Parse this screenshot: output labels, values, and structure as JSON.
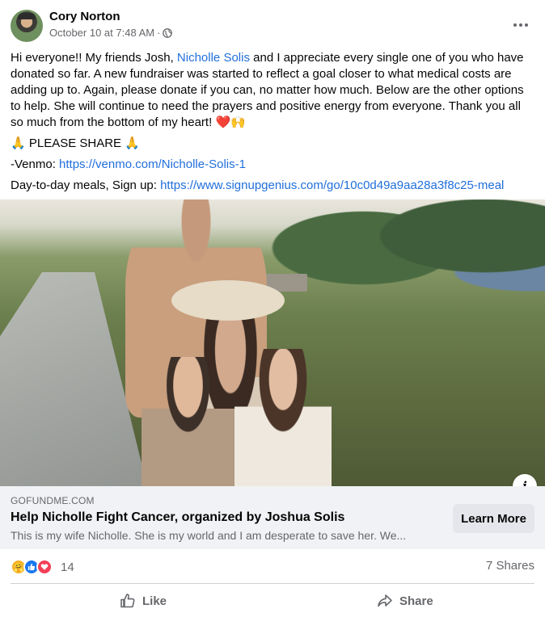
{
  "post": {
    "author": "Cory Norton",
    "timestamp": "October 10 at 7:48 AM",
    "separator": "·",
    "privacy_icon": "globe-icon",
    "more_icon": "more-horizontal-icon"
  },
  "content": {
    "p1_part1": "Hi everyone!! My friends Josh, ",
    "p1_mention": "Nicholle Solis",
    "p1_part2": " and I appreciate every single one of you who have donated so far. A new fundraiser was started to reflect a goal closer to what medical costs are adding up to. Again, please donate if you can, no matter how much. Below are the other options to help. She will continue to need the prayers and positive energy from everyone. Thank you all so much from the bottom of my heart! ",
    "p1_emoji": "❤️🙌",
    "share_line": "🙏 PLEASE SHARE 🙏",
    "venmo_label": "-Venmo: ",
    "venmo_link": "https://venmo.com/Nicholle-Solis-1",
    "meals_label": "Day-to-day meals, Sign up: ",
    "meals_link": "https://www.signupgenius.com/go/10c0d49a9aa28a3f8c25-meal"
  },
  "link_preview": {
    "domain": "GOFUNDME.COM",
    "title": "Help Nicholle Fight Cancer, organized by Joshua Solis",
    "description": "This is my wife Nicholle. She is my world and I am desperate to save her. We...",
    "button_label": "Learn More",
    "info_icon": "i"
  },
  "engagement": {
    "reaction_count": "14",
    "shares": "7 Shares",
    "reaction_types": [
      "care",
      "like",
      "love"
    ]
  },
  "actions": {
    "like_label": "Like",
    "share_label": "Share"
  },
  "colors": {
    "link": "#216fdb",
    "secondary_text": "#65676b",
    "like_blue": "#1877f2",
    "love_red": "#f33e58",
    "card_bg": "#f0f2f5"
  }
}
